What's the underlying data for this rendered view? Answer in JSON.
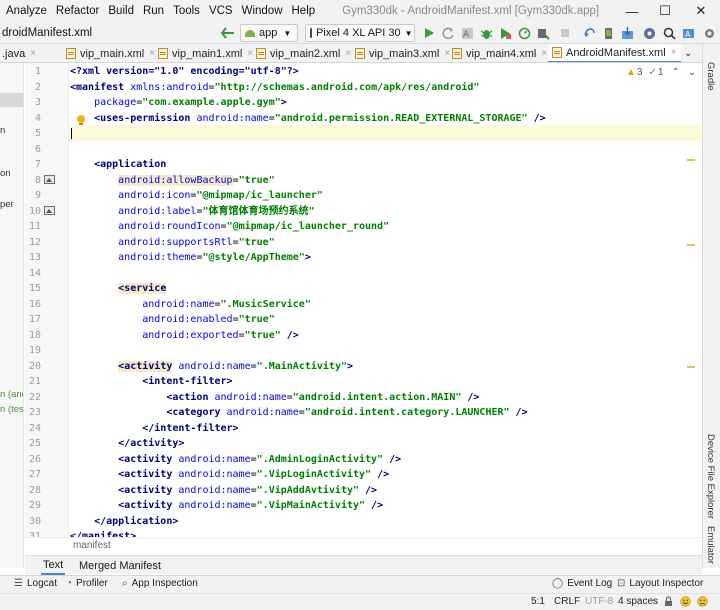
{
  "menu": [
    "Analyze",
    "Refactor",
    "Build",
    "Run",
    "Tools",
    "VCS",
    "Window",
    "Help"
  ],
  "window_title": "Gym330dk - AndroidManifest.xml [Gym330dk.app]",
  "window_controls": {
    "minimize": "—",
    "maximize": "☐",
    "close": "✕"
  },
  "nav": {
    "breadcrumb": "droidManifest.xml",
    "run_config": "app",
    "device": "Pixel 4 XL API 30"
  },
  "tabs": [
    {
      "label": ".java",
      "active": false
    },
    {
      "label": "vip_main.xml",
      "active": false
    },
    {
      "label": "vip_main1.xml",
      "active": false
    },
    {
      "label": "vip_main2.xml",
      "active": false
    },
    {
      "label": "vip_main3.xml",
      "active": false
    },
    {
      "label": "vip_main4.xml",
      "active": false
    },
    {
      "label": "AndroidManifest.xml",
      "active": true
    }
  ],
  "tab_close": "×",
  "inspections": {
    "warnings": "3",
    "typos": "1"
  },
  "left_fragments": [
    "n",
    "on",
    "per",
    "n (and",
    "n (test"
  ],
  "code_lines": [
    [
      {
        "t": "<?xml version=\"1.0\" encoding=\"utf-8\"?>",
        "c": "t-tag"
      }
    ],
    [
      {
        "t": "<manifest ",
        "c": "t-tag"
      },
      {
        "t": "xmlns:",
        "c": "t-attr"
      },
      {
        "t": "android",
        "c": "t-attr"
      },
      {
        "t": "=",
        "c": ""
      },
      {
        "t": "\"http://schemas.android.com/apk/res/android\"",
        "c": "t-str"
      }
    ],
    [
      {
        "t": "    package",
        "c": "t-attr"
      },
      {
        "t": "=",
        "c": ""
      },
      {
        "t": "\"com.example.apple.gym\"",
        "c": "t-str"
      },
      {
        "t": ">",
        "c": "t-tag"
      }
    ],
    [
      {
        "t": "    <uses-permission ",
        "c": "t-tag"
      },
      {
        "t": "android:name",
        "c": "t-attr"
      },
      {
        "t": "=",
        "c": ""
      },
      {
        "t": "\"android.permission.READ_EXTERNAL_STORAGE\"",
        "c": "t-str"
      },
      {
        "t": " />",
        "c": "t-tag"
      }
    ],
    [],
    [],
    [
      {
        "t": "    <application",
        "c": "t-tag"
      }
    ],
    [
      {
        "t": "        ",
        "c": ""
      },
      {
        "t": "android:allowBackup",
        "c": "t-attr t-hl"
      },
      {
        "t": "=",
        "c": ""
      },
      {
        "t": "\"true\"",
        "c": "t-str"
      }
    ],
    [
      {
        "t": "        android:icon",
        "c": "t-attr"
      },
      {
        "t": "=",
        "c": ""
      },
      {
        "t": "\"@mipmap/ic_launcher\"",
        "c": "t-str"
      }
    ],
    [
      {
        "t": "        android:label",
        "c": "t-attr"
      },
      {
        "t": "=",
        "c": ""
      },
      {
        "t": "\"体育馆体育场预约系统\"",
        "c": "t-str"
      }
    ],
    [
      {
        "t": "        android:roundIcon",
        "c": "t-attr"
      },
      {
        "t": "=",
        "c": ""
      },
      {
        "t": "\"@mipmap/ic_launcher_round\"",
        "c": "t-str"
      }
    ],
    [
      {
        "t": "        android:supportsRtl",
        "c": "t-attr"
      },
      {
        "t": "=",
        "c": ""
      },
      {
        "t": "\"true\"",
        "c": "t-str"
      }
    ],
    [
      {
        "t": "        android:theme",
        "c": "t-attr"
      },
      {
        "t": "=",
        "c": ""
      },
      {
        "t": "\"@style/AppTheme\"",
        "c": "t-str"
      },
      {
        "t": ">",
        "c": "t-tag"
      }
    ],
    [],
    [
      {
        "t": "        ",
        "c": ""
      },
      {
        "t": "<service",
        "c": "t-tag t-hl"
      }
    ],
    [
      {
        "t": "            android:name",
        "c": "t-attr"
      },
      {
        "t": "=",
        "c": ""
      },
      {
        "t": "\".MusicService\"",
        "c": "t-str"
      }
    ],
    [
      {
        "t": "            android:enabled",
        "c": "t-attr"
      },
      {
        "t": "=",
        "c": ""
      },
      {
        "t": "\"true\"",
        "c": "t-str"
      }
    ],
    [
      {
        "t": "            android:exported",
        "c": "t-attr"
      },
      {
        "t": "=",
        "c": ""
      },
      {
        "t": "\"true\"",
        "c": "t-str"
      },
      {
        "t": " />",
        "c": "t-tag"
      }
    ],
    [],
    [
      {
        "t": "        ",
        "c": ""
      },
      {
        "t": "<activity",
        "c": "t-tag t-hl"
      },
      {
        "t": " android:name",
        "c": "t-attr"
      },
      {
        "t": "=",
        "c": ""
      },
      {
        "t": "\".MainActivity\"",
        "c": "t-str"
      },
      {
        "t": ">",
        "c": "t-tag"
      }
    ],
    [
      {
        "t": "            <intent-filter>",
        "c": "t-tag"
      }
    ],
    [
      {
        "t": "                <action ",
        "c": "t-tag"
      },
      {
        "t": "android:name",
        "c": "t-attr"
      },
      {
        "t": "=",
        "c": ""
      },
      {
        "t": "\"android.intent.action.MAIN\"",
        "c": "t-str"
      },
      {
        "t": " />",
        "c": "t-tag"
      }
    ],
    [
      {
        "t": "                <category ",
        "c": "t-tag"
      },
      {
        "t": "android:name",
        "c": "t-attr"
      },
      {
        "t": "=",
        "c": ""
      },
      {
        "t": "\"android.intent.category.LAUNCHER\"",
        "c": "t-str"
      },
      {
        "t": " />",
        "c": "t-tag"
      }
    ],
    [
      {
        "t": "            </intent-filter>",
        "c": "t-tag"
      }
    ],
    [
      {
        "t": "        </activity>",
        "c": "t-tag"
      }
    ],
    [
      {
        "t": "        <activity ",
        "c": "t-tag"
      },
      {
        "t": "android:name",
        "c": "t-attr"
      },
      {
        "t": "=",
        "c": ""
      },
      {
        "t": "\".AdminLoginActivity\"",
        "c": "t-str"
      },
      {
        "t": " />",
        "c": "t-tag"
      }
    ],
    [
      {
        "t": "        <activity ",
        "c": "t-tag"
      },
      {
        "t": "android:name",
        "c": "t-attr"
      },
      {
        "t": "=",
        "c": ""
      },
      {
        "t": "\".VipLoginActivity\"",
        "c": "t-str"
      },
      {
        "t": " />",
        "c": "t-tag"
      }
    ],
    [
      {
        "t": "        <activity ",
        "c": "t-tag"
      },
      {
        "t": "android:name",
        "c": "t-attr"
      },
      {
        "t": "=",
        "c": ""
      },
      {
        "t": "\".VipAddAvtivity\"",
        "c": "t-str"
      },
      {
        "t": " />",
        "c": "t-tag"
      }
    ],
    [
      {
        "t": "        <activity ",
        "c": "t-tag"
      },
      {
        "t": "android:name",
        "c": "t-attr"
      },
      {
        "t": "=",
        "c": ""
      },
      {
        "t": "\".VipMainActivity\"",
        "c": "t-str"
      },
      {
        "t": " />",
        "c": "t-tag"
      }
    ],
    [
      {
        "t": "    </application>",
        "c": "t-tag"
      }
    ],
    [
      {
        "t": "</manifest>",
        "c": "t-tag"
      }
    ]
  ],
  "editor_breadcrumb": "manifest",
  "sub_tabs": [
    {
      "label": "Text",
      "active": true
    },
    {
      "label": "Merged Manifest",
      "active": false
    }
  ],
  "right_tools": {
    "gradle": "Gradle",
    "device_file_explorer": "Device File Explorer",
    "emulator": "Emulator"
  },
  "bottom_tools": {
    "logcat": "Logcat",
    "profiler": "Profiler",
    "app_inspection": "App Inspection",
    "event_log": "Event Log",
    "layout_inspector": "Layout Inspector"
  },
  "status": {
    "position": "5:1",
    "line_sep": "CRLF",
    "encoding": "UTF-8",
    "indent": "4 spaces"
  }
}
